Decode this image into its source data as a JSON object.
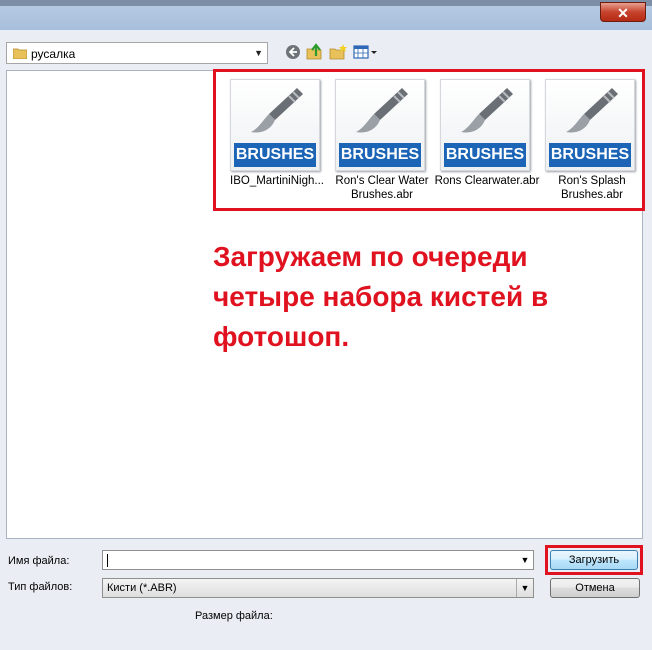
{
  "window": {
    "close_glyph": "✕"
  },
  "toolbar": {
    "look_in_value": "русалка",
    "icons": [
      "back-icon",
      "up-folder-icon",
      "new-folder-icon",
      "view-menu-icon"
    ]
  },
  "files": [
    {
      "thumb_label": "BRUSHES",
      "name": "IBO_MartiniNigh..."
    },
    {
      "thumb_label": "BRUSHES",
      "name": "Ron's Clear Water Brushes.abr"
    },
    {
      "thumb_label": "BRUSHES",
      "name": "Rons Clearwater.abr"
    },
    {
      "thumb_label": "BRUSHES",
      "name": "Ron's Splash Brushes.abr"
    }
  ],
  "annotation": {
    "text": "Загружаем по очереди четыре набора кистей в фотошоп.",
    "color": "#e0121f"
  },
  "form": {
    "filename_label": "Имя файла:",
    "filename_value": "",
    "filetype_label": "Тип файлов:",
    "filetype_value": "Кисти (*.ABR)",
    "filesize_label": "Размер файла:",
    "load_button": "Загрузить",
    "cancel_button": "Отмена"
  }
}
